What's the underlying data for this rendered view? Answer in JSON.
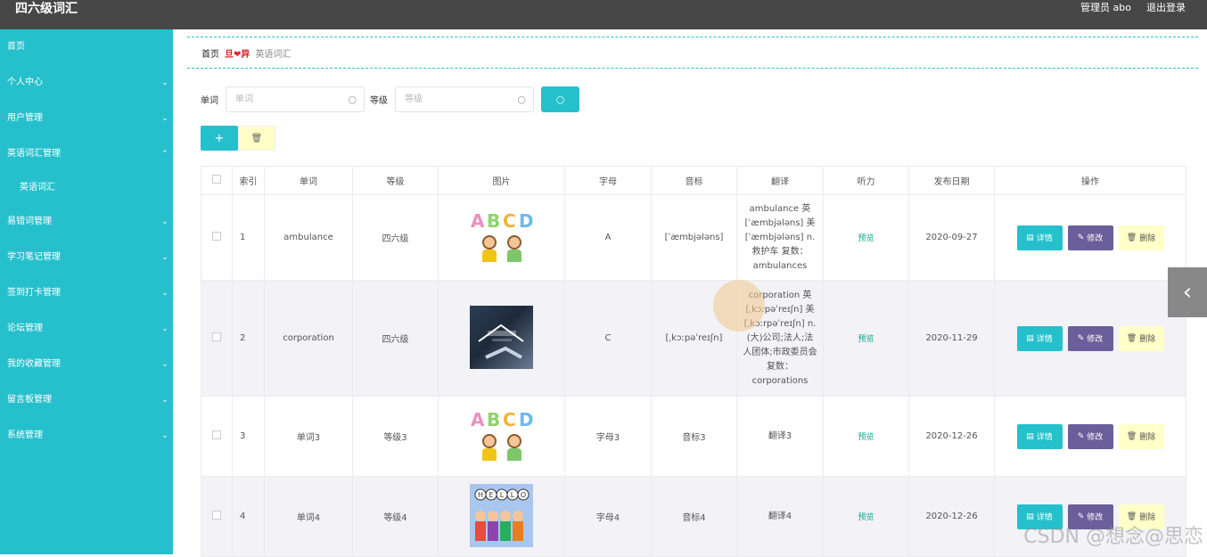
{
  "header": {
    "title": "四六级词汇",
    "admin": "管理员 abo",
    "logout": "退出登录"
  },
  "sidebar": {
    "items": [
      {
        "label": "首页",
        "chev": ""
      },
      {
        "label": "个人中心",
        "chev": "⌄"
      },
      {
        "label": "用户管理",
        "chev": "⌄"
      },
      {
        "label": "英语词汇管理",
        "chev": "⌃"
      },
      {
        "label": "英语词汇",
        "chev": ""
      },
      {
        "label": "易错词管理",
        "chev": "⌄"
      },
      {
        "label": "学习笔记管理",
        "chev": "⌄"
      },
      {
        "label": "签到打卡管理",
        "chev": "⌄"
      },
      {
        "label": "论坛管理",
        "chev": "⌄"
      },
      {
        "label": "我的收藏管理",
        "chev": "⌄"
      },
      {
        "label": "留言板管理",
        "chev": "⌄"
      },
      {
        "label": "系统管理",
        "chev": "⌄"
      }
    ]
  },
  "breadcrumb": {
    "home": "首页",
    "sep": "旦❤异",
    "current": "英语词汇"
  },
  "search": {
    "word_label": "单词",
    "word_placeholder": "单词",
    "level_label": "等级",
    "level_placeholder": "等级",
    "search_icon": "search-icon"
  },
  "actions": {
    "add_icon": "+",
    "delete_icon": "🗑"
  },
  "table": {
    "headers": [
      "",
      "索引",
      "单词",
      "等级",
      "图片",
      "字母",
      "音标",
      "翻译",
      "听力",
      "发布日期",
      "操作"
    ],
    "rows": [
      {
        "index": "1",
        "word": "ambulance",
        "level": "四六级",
        "image": "abcd-kids",
        "letter": "A",
        "phonetic": "[ˈæmbjələns]",
        "translation": "ambulance 英 [ˈæmbjələns] 美 [ˈæmbjələns] n. 救护车 复数： ambulances",
        "listen": "预览",
        "date": "2020-09-27"
      },
      {
        "index": "2",
        "word": "corporation",
        "level": "四六级",
        "image": "business-handshake",
        "letter": "C",
        "phonetic": "[ˌkɔːpəˈreɪʃn]",
        "translation": "corporation 英 [ˌkɔːpəˈreɪʃn] 美 [ˌkɔːrpəˈreɪʃn] n. (大)公司;法人;法人团体;市政委员会 复数： corporations",
        "listen": "预览",
        "date": "2020-11-29"
      },
      {
        "index": "3",
        "word": "单词3",
        "level": "等级3",
        "image": "abcd-kids",
        "letter": "字母3",
        "phonetic": "音标3",
        "translation": "翻译3",
        "listen": "预览",
        "date": "2020-12-26"
      },
      {
        "index": "4",
        "word": "单词4",
        "level": "等级4",
        "image": "hello-kids",
        "letter": "字母4",
        "phonetic": "音标4",
        "translation": "翻译4",
        "listen": "预览",
        "date": "2020-12-26"
      }
    ],
    "op_labels": {
      "detail": "详情",
      "edit": "修改",
      "delete": "删除"
    }
  },
  "sidetab": {
    "icon": "‹"
  },
  "watermark": "CSDN @想念@思恋",
  "colors": {
    "accent": "#26c0cc",
    "topbar": "#474747",
    "edit": "#6a5f9a",
    "delete": "#ffffc8",
    "preview": "#12a68e"
  }
}
